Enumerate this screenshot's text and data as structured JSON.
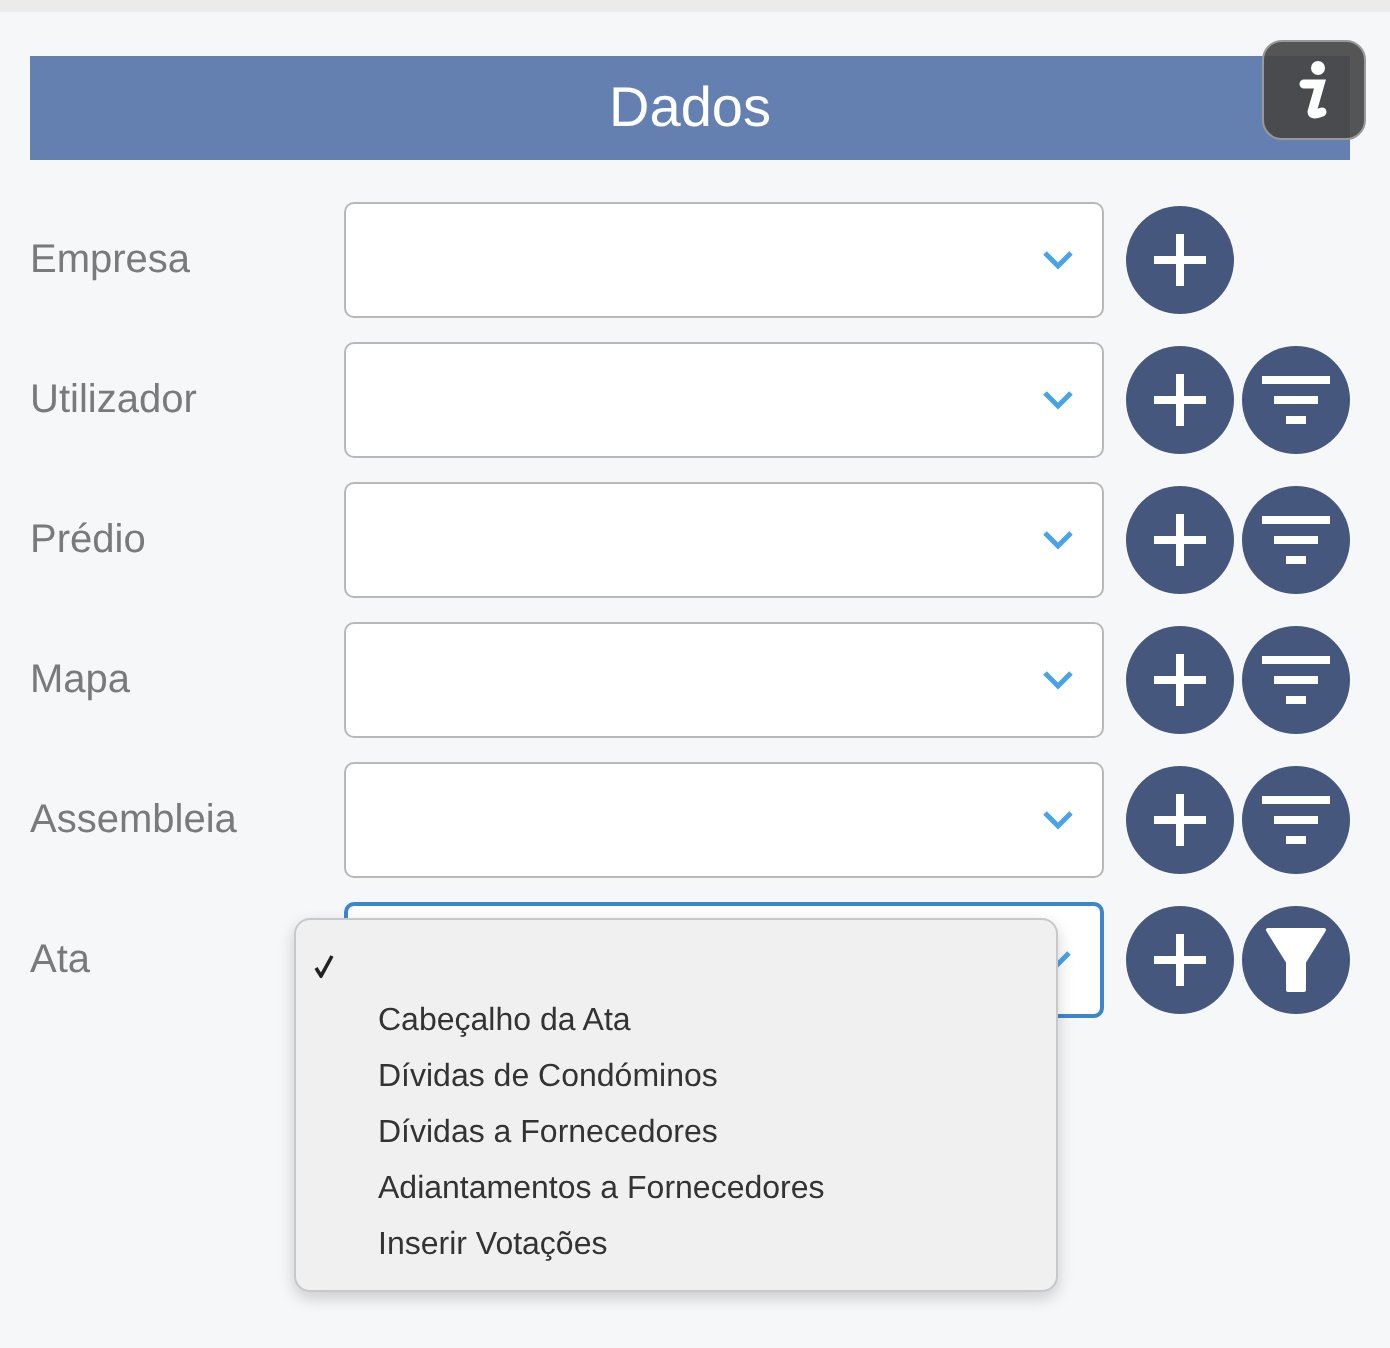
{
  "header": {
    "title": "Dados"
  },
  "fields": [
    {
      "label": "Empresa",
      "focused": false,
      "buttons": [
        {
          "kind": "add"
        }
      ]
    },
    {
      "label": "Utilizador",
      "focused": false,
      "buttons": [
        {
          "kind": "add"
        },
        {
          "kind": "filter-lines"
        }
      ]
    },
    {
      "label": "Prédio",
      "focused": false,
      "buttons": [
        {
          "kind": "add"
        },
        {
          "kind": "filter-lines"
        }
      ]
    },
    {
      "label": "Mapa",
      "focused": false,
      "buttons": [
        {
          "kind": "add"
        },
        {
          "kind": "filter-lines"
        }
      ]
    },
    {
      "label": "Assembleia",
      "focused": false,
      "buttons": [
        {
          "kind": "add"
        },
        {
          "kind": "filter-lines"
        }
      ]
    },
    {
      "label": "Ata",
      "focused": true,
      "buttons": [
        {
          "kind": "add"
        },
        {
          "kind": "funnel"
        }
      ],
      "dropdown": {
        "options": [
          {
            "selected": true
          },
          {
            "label": "Cabeçalho da Ata",
            "selected": false
          },
          {
            "label": "Dívidas de Condóminos",
            "selected": false
          },
          {
            "label": "Dívidas a Fornecedores",
            "selected": false
          },
          {
            "label": "Adiantamentos a Fornecedores",
            "selected": false
          },
          {
            "label": "Inserir Votações",
            "selected": false
          }
        ]
      }
    }
  ]
}
